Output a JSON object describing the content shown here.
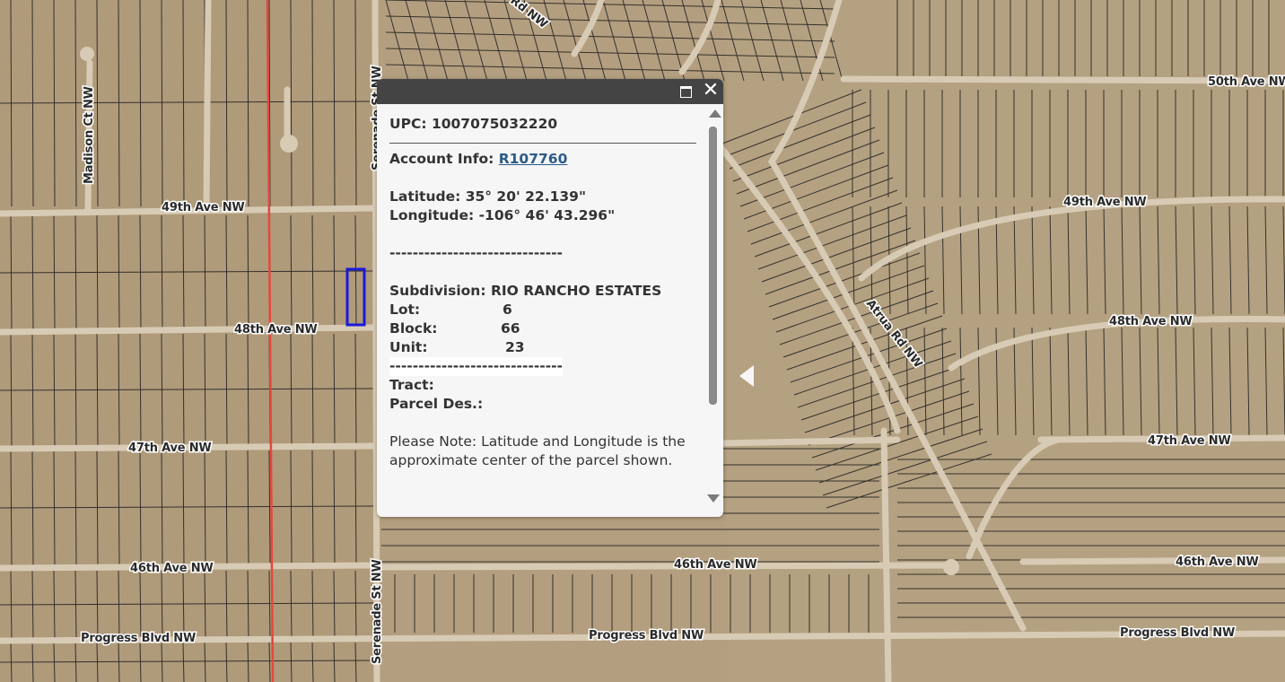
{
  "map": {
    "roads": {
      "madison_ct": "Madison Ct NW",
      "serenade_st_top": "Serenade St NW",
      "serenade_st_bottom": "Serenade St NW",
      "ave49_left": "49th Ave NW",
      "ave49_right": "49th Ave NW",
      "ave48_left": "48th Ave NW",
      "ave48_right": "48th Ave NW",
      "ave47_left": "47th Ave NW",
      "ave47_right": "47th Ave NW",
      "ave46_left": "46th Ave NW",
      "ave46_mid": "46th Ave NW",
      "ave46_right": "46th Ave NW",
      "ave50_right": "50th Ave NW",
      "progress_left": "Progress Blvd NW",
      "progress_mid": "Progress Blvd NW",
      "progress_right": "Progress Blvd NW",
      "atrua_rd": "Atrua Rd NW",
      "rd_top": "Rd NW"
    },
    "colors": {
      "ground": "#b39e7f",
      "parcel_line": "#1e1e1e",
      "road": "#d8cbb5",
      "boundary": "#e8463c",
      "selection": "#1a1adb"
    }
  },
  "popup": {
    "upc_label": "UPC:",
    "upc_value": "1007075032220",
    "account_label": "Account Info:",
    "account_link": "R107760",
    "latitude_label": "Latitude:",
    "latitude_value": "35° 20' 22.139\"",
    "longitude_label": "Longitude:",
    "longitude_value": "-106° 46' 43.296\"",
    "separator": "------------------------------",
    "subdivision_label": "Subdivision:",
    "subdivision_value": "RIO RANCHO ESTATES",
    "lot_label": "Lot:",
    "lot_value": "6",
    "block_label": "Block:",
    "block_value": "66",
    "unit_label": "Unit:",
    "unit_value": "23",
    "tract_label": "Tract:",
    "parcel_des_label": "Parcel Des.:",
    "note": "Please Note: Latitude and Longitude is the approximate center of the parcel shown.",
    "icons": {
      "maximize": "maximize-icon",
      "close": "close-icon"
    }
  }
}
